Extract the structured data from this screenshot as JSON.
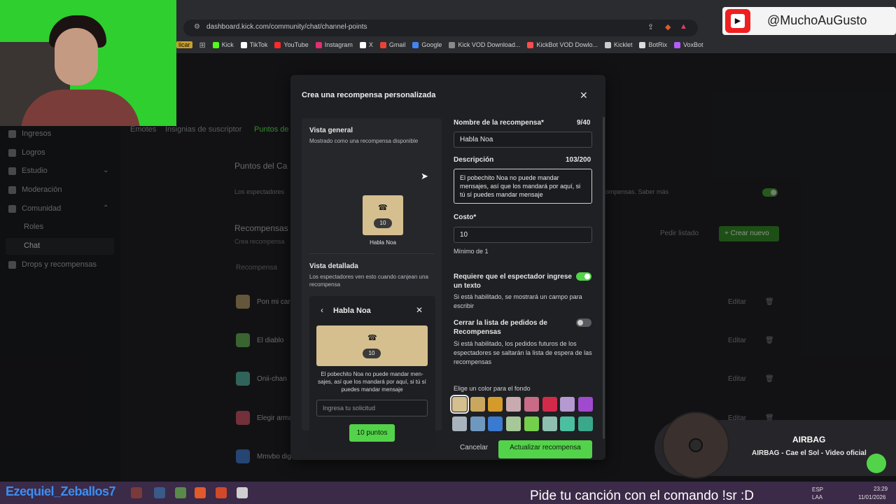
{
  "browser": {
    "url": "dashboard.kick.com/community/chat/channel-points",
    "bookmarks_prefix": "licar",
    "bookmarks": [
      {
        "label": "Kick",
        "color": "#53fc18"
      },
      {
        "label": "TikTok",
        "color": "#ffffff"
      },
      {
        "label": "YouTube",
        "color": "#ff2a2a"
      },
      {
        "label": "Instagram",
        "color": "#e1306c"
      },
      {
        "label": "X",
        "color": "#ffffff"
      },
      {
        "label": "Gmail",
        "color": "#ea4335"
      },
      {
        "label": "Google",
        "color": "#4285f4"
      },
      {
        "label": "Kick VOD Download...",
        "color": "#8a8a8a"
      },
      {
        "label": "KickBot VOD Dowlo...",
        "color": "#ff4d4d"
      },
      {
        "label": "Kicklet",
        "color": "#cccccc"
      },
      {
        "label": "BotRix",
        "color": "#dddddd"
      },
      {
        "label": "VoxBot",
        "color": "#b45cff"
      }
    ]
  },
  "sidebar": {
    "items": [
      {
        "label": "Ingresos"
      },
      {
        "label": "Logros"
      },
      {
        "label": "Estudio"
      },
      {
        "label": "Moderación"
      },
      {
        "label": "Comunidad"
      },
      {
        "label": "Roles"
      },
      {
        "label": "Chat"
      },
      {
        "label": "Drops y recompensas"
      }
    ]
  },
  "background": {
    "tabs": [
      "Emotes",
      "Insignias de suscriptor",
      "Puntos de"
    ],
    "section_title": "Puntos del Ca",
    "section_desc_left": "Los espectadores",
    "section_desc_right": "ompensas. Saber más",
    "rewards_title": "Recompensas",
    "rewards_sub": "Crea recompensa",
    "column_header": "Recompensa",
    "request_list": "Pedir listado",
    "create_new": "+ Crear nuevo",
    "edit_label": "Editar",
    "rows": [
      {
        "label": "Pon mi can",
        "color": "#9a845a"
      },
      {
        "label": "El diablo",
        "color": "#5a9a4a"
      },
      {
        "label": "Onii-chan",
        "color": "#4a9a8a"
      },
      {
        "label": "Elegir arma",
        "color": "#b04a5a"
      },
      {
        "label": "Mmvbo dig",
        "color": "#3a6ab0"
      }
    ]
  },
  "modal": {
    "title": "Crea una recompensa personalizada",
    "preview": {
      "general_title": "Vista general",
      "general_sub": "Mostrado como una recompensa disponible",
      "tile_cost": "10",
      "tile_name": "Habla Noa",
      "detail_title": "Vista detallada",
      "detail_sub": "Los espectadores ven esto cuando canjean una recompensa",
      "card_title": "Habla Noa",
      "card_cost": "10",
      "card_desc": "El pobechito Noa no puede mandar men-sajes, así que los mandará por aquí, si tú sí puedes mandar mensaje",
      "card_input_placeholder": "Ingresa tu solicitud",
      "card_button": "10 puntos"
    },
    "form": {
      "name_label": "Nombre de la recompensa*",
      "name_count": "9/40",
      "name_value": "Habla Noa",
      "desc_label": "Descripción",
      "desc_count": "103/200",
      "desc_value": "El pobechito Noa no puede mandar mensajes, así que los mandará por aquí, si tú sí puedes mandar mensaje",
      "cost_label": "Costo*",
      "cost_value": "10",
      "cost_help": "Mínimo de 1",
      "require_label": "Requiere que el espectador ingrese un texto",
      "require_on": true,
      "require_help": "Si está habilitado, se mostrará un campo para escribir",
      "close_label": "Cerrar la lista de pedidos de Recompensas",
      "close_on": false,
      "close_help": "Si está habilitado, los pedidos futuros de los espectadores se saltarán la lista de espera de las recompensas",
      "color_label": "Elige un color para el fondo",
      "colors_row1": [
        "#d6bf8f",
        "#c9a75e",
        "#d49a2a",
        "#c9aab0",
        "#c96a88",
        "#d42a4a",
        "#b49ad0",
        "#a04ad0"
      ],
      "colors_row2": [
        "#a9b3bd",
        "#6f98c0",
        "#3a7ad0",
        "#a6c898",
        "#74d04a",
        "#8fbfb0",
        "#4ac0a0",
        "#3aa88a"
      ],
      "cancel": "Cancelar",
      "submit": "Actualizar recompensa"
    }
  },
  "overlay": {
    "yt_handle": "@MuchoAuGusto",
    "music_title": "AIRBAG",
    "music_sub": "AIRBAG - Cae el Sol - Video oficial",
    "taskbar_name": "Ezequiel_Zeballos7",
    "marquee": "Pide tu canción con el comando !sr :D",
    "lang": "ESP",
    "lang2": "LAA",
    "time": "23:29",
    "date": "11/01/2026"
  }
}
